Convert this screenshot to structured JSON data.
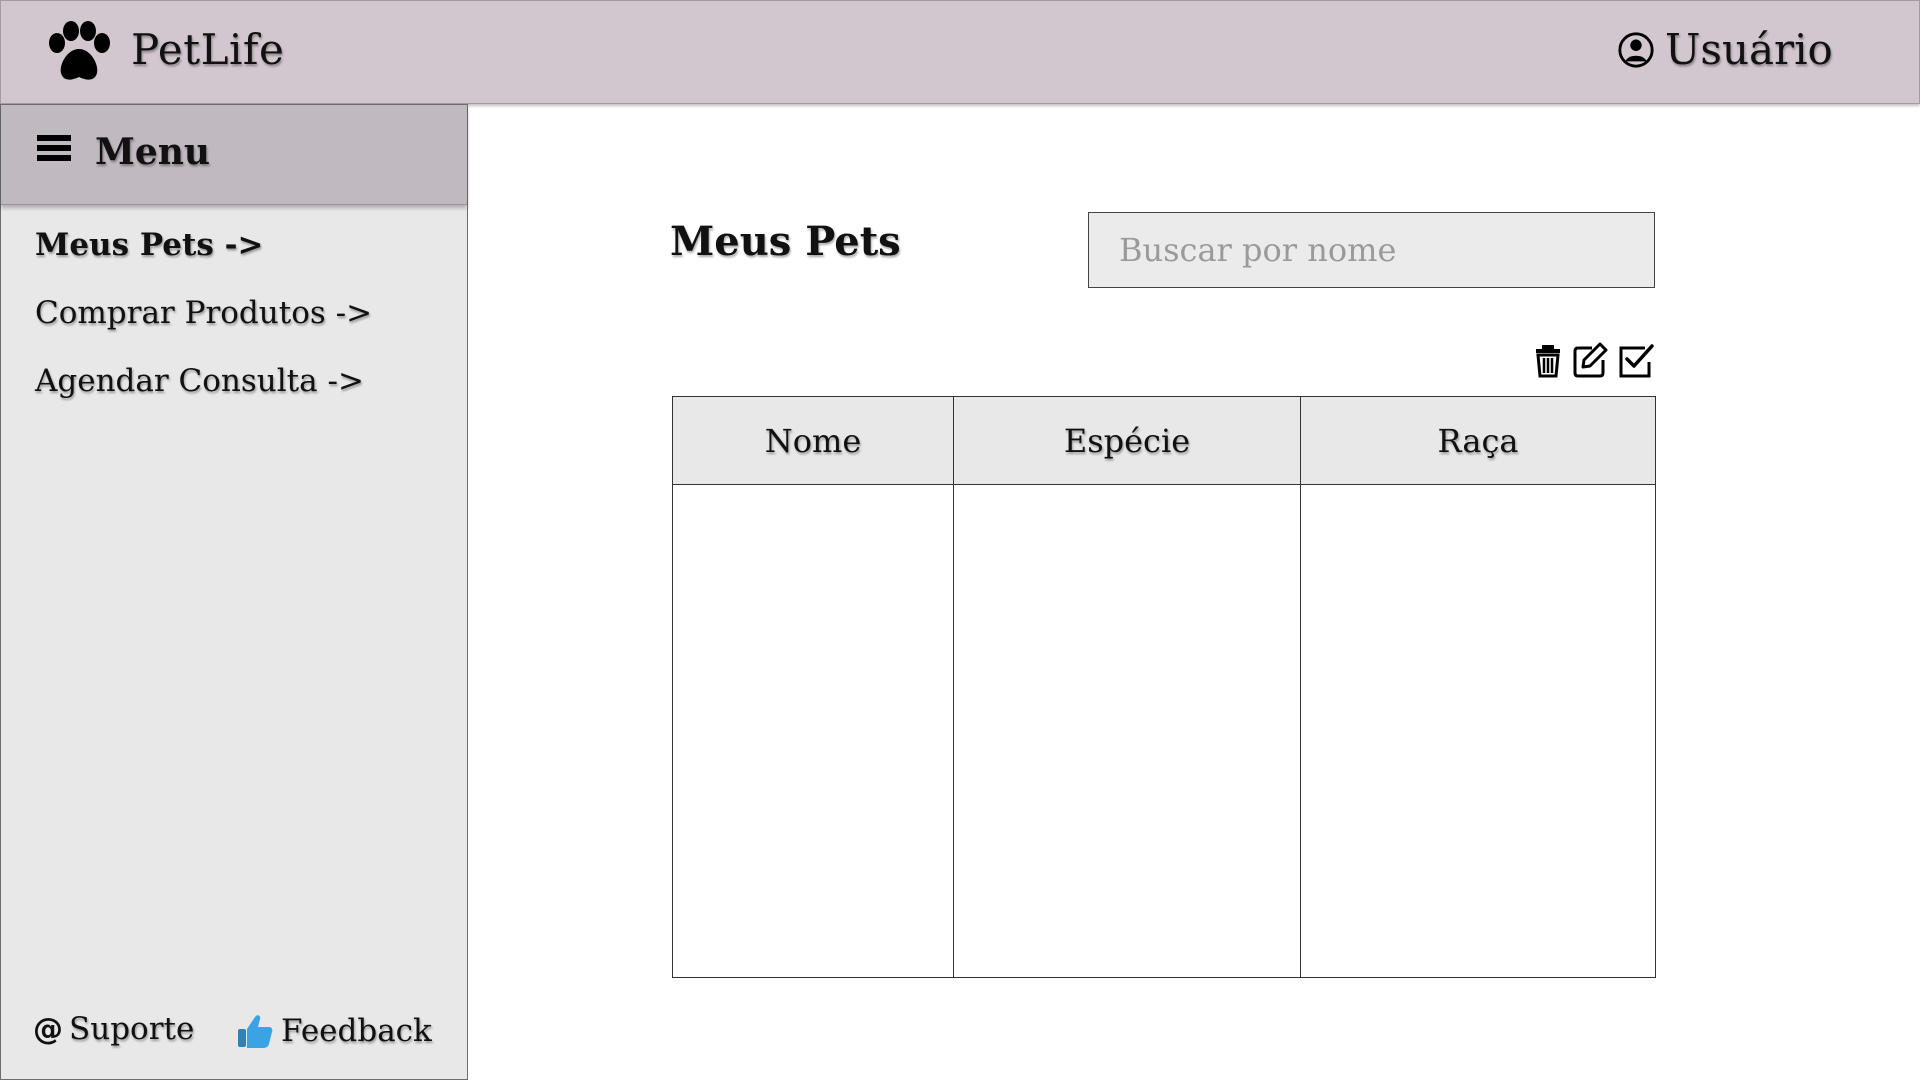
{
  "app": {
    "title": "PetLife",
    "user_label": "Usuário"
  },
  "sidebar": {
    "menu_title": "Menu",
    "items": [
      {
        "label": "Meus Pets ->"
      },
      {
        "label": "Comprar Produtos ->"
      },
      {
        "label": "Agendar Consulta ->"
      }
    ],
    "footer": {
      "support_label": "Suporte",
      "support_icon": "@",
      "feedback_label": "Feedback"
    }
  },
  "main": {
    "page_title": "Meus Pets",
    "search": {
      "placeholder": "Buscar por nome",
      "value": ""
    },
    "toolbar": [
      "trash-icon",
      "edit-icon",
      "check-square-icon"
    ],
    "table": {
      "columns": [
        "Nome",
        "Espécie",
        "Raça"
      ],
      "rows": []
    }
  },
  "colors": {
    "header_bg": "#d2c6cf",
    "menu_header_bg": "#c1b9c0",
    "sidebar_bg": "#e8e8e8",
    "feedback_thumb": "#3aa3e3"
  }
}
